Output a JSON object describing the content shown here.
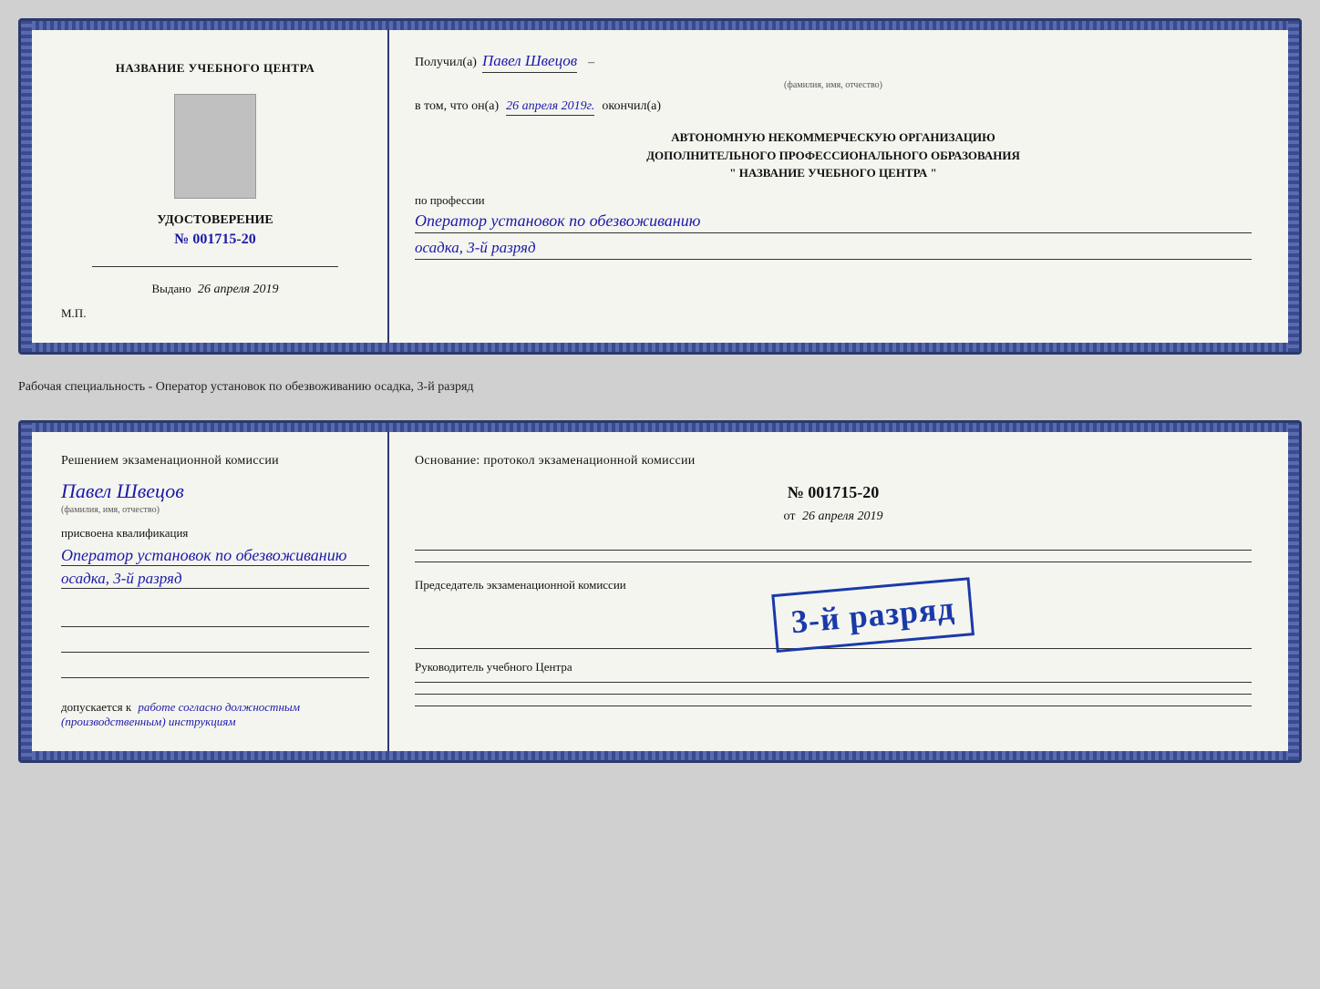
{
  "doc1": {
    "left": {
      "title": "НАЗВАНИЕ УЧЕБНОГО ЦЕНТРА",
      "cert_label": "УДОСТОВЕРЕНИЕ",
      "cert_number": "№ 001715-20",
      "issued_label": "Выдано",
      "issued_date": "26 апреля 2019",
      "mp_label": "М.П."
    },
    "right": {
      "received_prefix": "Получил(а)",
      "received_name": "Павел Швецов",
      "fio_label": "(фамилия, имя, отчество)",
      "dash": "–",
      "in_that_prefix": "в том, что он(а)",
      "handwritten_date": "26 апреля 2019г.",
      "finished_word": "окончил(а)",
      "org_line1": "АВТОНОМНУЮ НЕКОММЕРЧЕСКУЮ ОРГАНИЗАЦИЮ",
      "org_line2": "ДОПОЛНИТЕЛЬНОГО ПРОФЕССИОНАЛЬНОГО ОБРАЗОВАНИЯ",
      "org_line3": "\"   НАЗВАНИЕ УЧЕБНОГО ЦЕНТРА   \"",
      "profession_label": "по профессии",
      "profession_name": "Оператор установок по обезвоживанию",
      "profession_rank": "осадка, 3-й разряд"
    }
  },
  "separator": {
    "text": "Рабочая специальность - Оператор установок по обезвоживанию осадка, 3-й разряд"
  },
  "doc2": {
    "left": {
      "decision_title": "Решением  экзаменационной  комиссии",
      "person_name": "Павел Швецов",
      "fio_label": "(фамилия, имя, отчество)",
      "assigned_label": "присвоена квалификация",
      "qual_name": "Оператор установок по обезвоживанию",
      "qual_rank": "осадка, 3-й разряд",
      "admitted_prefix": "допускается к",
      "admitted_text": "работе согласно должностным (производственным) инструкциям"
    },
    "right": {
      "basis_title": "Основание: протокол экзаменационной  комиссии",
      "protocol_number": "№  001715-20",
      "from_prefix": "от",
      "from_date": "26 апреля 2019",
      "chairman_label": "Председатель экзаменационной комиссии",
      "head_label": "Руководитель учебного Центра"
    },
    "stamp": {
      "text": "3-й разряд"
    }
  }
}
